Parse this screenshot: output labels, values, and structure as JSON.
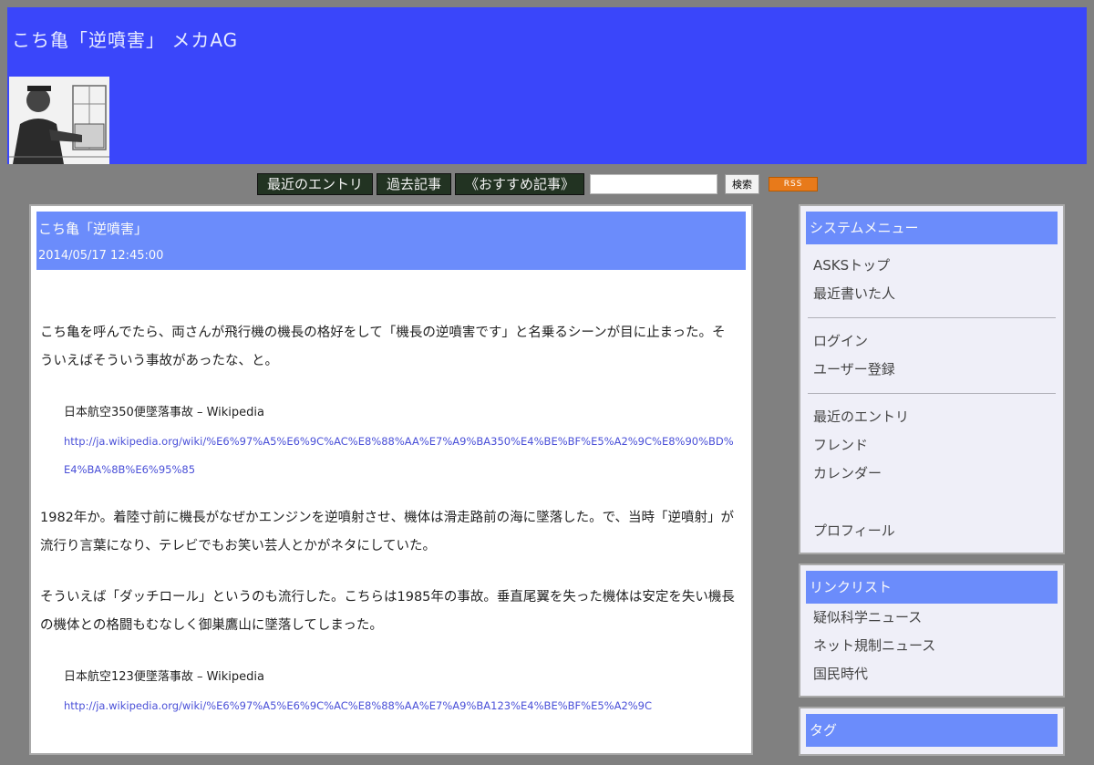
{
  "site": {
    "title": "こち亀「逆噴害」 メカAG"
  },
  "nav": {
    "items": [
      "最近のエントリ",
      "過去記事",
      "《おすすめ記事》"
    ],
    "search_placeholder": "",
    "search_button": "検索",
    "rss_label": "RSS"
  },
  "entry": {
    "title": "こち亀「逆噴害」",
    "date": "2014/05/17 12:45:00",
    "p1": "こち亀を呼んでたら、両さんが飛行機の機長の格好をして「機長の逆噴害です」と名乗るシーンが目に止まった。そういえばそういう事故があったな、と。",
    "quote1_title": "日本航空350便墜落事故 – Wikipedia",
    "quote1_url": "http://ja.wikipedia.org/wiki/%E6%97%A5%E6%9C%AC%E8%88%AA%E7%A9%BA350%E4%BE%BF%E5%A2%9C%E8%90%BD%E4%BA%8B%E6%95%85",
    "p2": "1982年か。着陸寸前に機長がなぜかエンジンを逆噴射させ、機体は滑走路前の海に墜落した。で、当時「逆噴射」が流行り言葉になり、テレビでもお笑い芸人とかがネタにしていた。",
    "p3": "そういえば「ダッチロール」というのも流行した。こちらは1985年の事故。垂直尾翼を失った機体は安定を失い機長の機体との格闘もむなしく御巣鷹山に墜落してしまった。",
    "quote2_title": "日本航空123便墜落事故 – Wikipedia",
    "quote2_url": "http://ja.wikipedia.org/wiki/%E6%97%A5%E6%9C%AC%E8%88%AA%E7%A9%BA123%E4%BE%BF%E5%A2%9C"
  },
  "sidebar": {
    "system_menu": {
      "title": "システムメニュー",
      "group1": [
        "ASKSトップ",
        "最近書いた人"
      ],
      "group2": [
        "ログイン",
        "ユーザー登録"
      ],
      "group3": [
        "最近のエントリ",
        "フレンド",
        "カレンダー"
      ],
      "group4": [
        "プロフィール"
      ]
    },
    "link_list": {
      "title": "リンクリスト",
      "items": [
        "疑似科学ニュース",
        "ネット規制ニュース",
        "国民時代"
      ]
    },
    "tags": {
      "title": "タグ"
    }
  }
}
